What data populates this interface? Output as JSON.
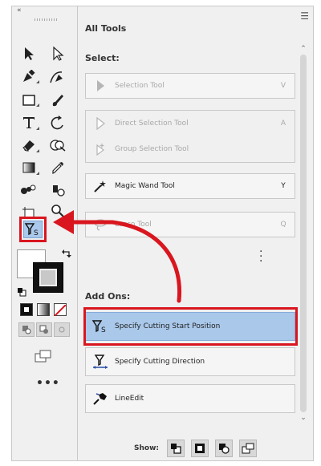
{
  "toolbar": {
    "collapse_glyph": "«",
    "more_glyph": "•••"
  },
  "panel": {
    "title": "All Tools",
    "menu_glyph": "☰",
    "select_section": "Select:",
    "addons_section": "Add Ons:",
    "tools": [
      {
        "label": "Selection Tool",
        "key": "V",
        "icon": "selection-arrow-icon",
        "enabled": false
      },
      {
        "label": "Direct Selection Tool",
        "key": "A",
        "icon": "direct-selection-icon",
        "enabled": false
      },
      {
        "label": "Group Selection Tool",
        "key": "",
        "icon": "group-selection-icon",
        "enabled": false
      },
      {
        "label": "Magic Wand Tool",
        "key": "Y",
        "icon": "magic-wand-icon",
        "enabled": true
      },
      {
        "label": "Lasso Tool",
        "key": "Q",
        "icon": "lasso-icon",
        "enabled": false
      }
    ],
    "addons": [
      {
        "label": "Specify Cutting Start Position",
        "icon": "cutting-start-icon",
        "selected": true
      },
      {
        "label": "Specify Cutting Direction",
        "icon": "cutting-direction-icon",
        "selected": false
      },
      {
        "label": "LineEdit",
        "icon": "line-edit-icon",
        "selected": false
      }
    ],
    "show_label": "Show:"
  },
  "colors": {
    "highlight": "#a9c8ea",
    "annotation_red": "#d9161f"
  }
}
